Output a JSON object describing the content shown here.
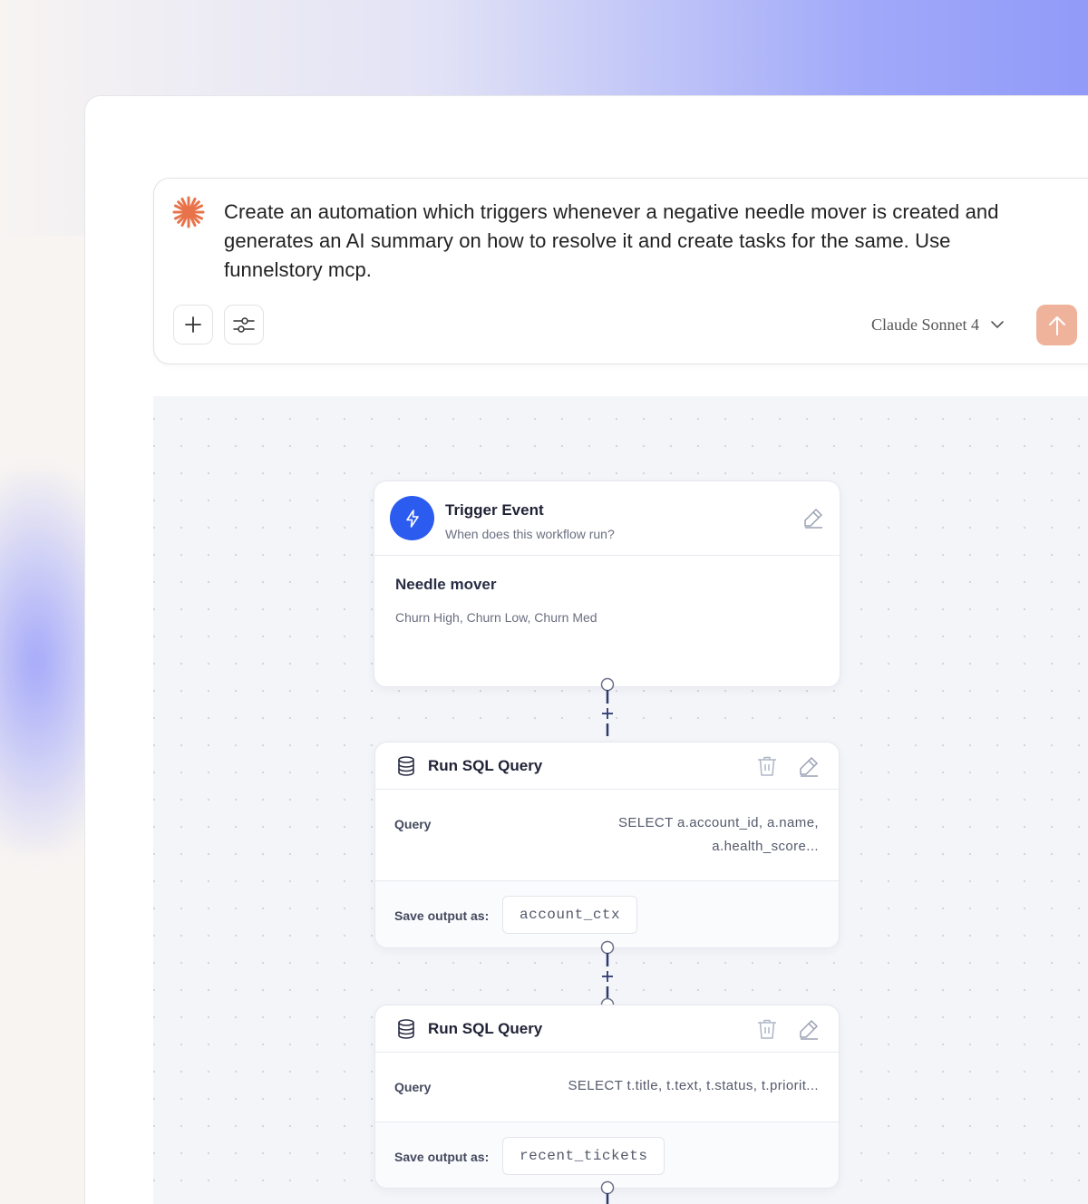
{
  "prompt": {
    "text": "Create an automation which triggers whenever a negative needle mover is created and generates an AI summary on how to resolve it and create tasks for the same. Use funnelstory mcp.",
    "model": "Claude Sonnet 4",
    "icons": {
      "brand": "sparkle-icon",
      "add": "plus-icon",
      "settings": "sliders-icon",
      "model_dropdown": "chevron-down-icon",
      "send": "arrow-up-icon"
    }
  },
  "colors": {
    "accent_send": "#efb39b",
    "trigger_icon_bg": "#2b5bef",
    "spark": "#e8734a",
    "connector": "#2c3a6e"
  },
  "workflow": {
    "trigger": {
      "title": "Trigger Event",
      "subtitle": "When does this workflow run?",
      "body_title": "Needle mover",
      "body_sub": "Churn High, Churn Low, Churn Med"
    },
    "steps": [
      {
        "title": "Run SQL Query",
        "query_label": "Query",
        "query_line1": "SELECT a.account_id, a.name,",
        "query_line2": "a.health_score...",
        "save_label": "Save output as:",
        "save_value": "account_ctx"
      },
      {
        "title": "Run SQL Query",
        "query_label": "Query",
        "query_line1": "SELECT t.title, t.text, t.status, t.priorit...",
        "save_label": "Save output as:",
        "save_value": "recent_tickets"
      }
    ],
    "connector_symbol": "+"
  }
}
